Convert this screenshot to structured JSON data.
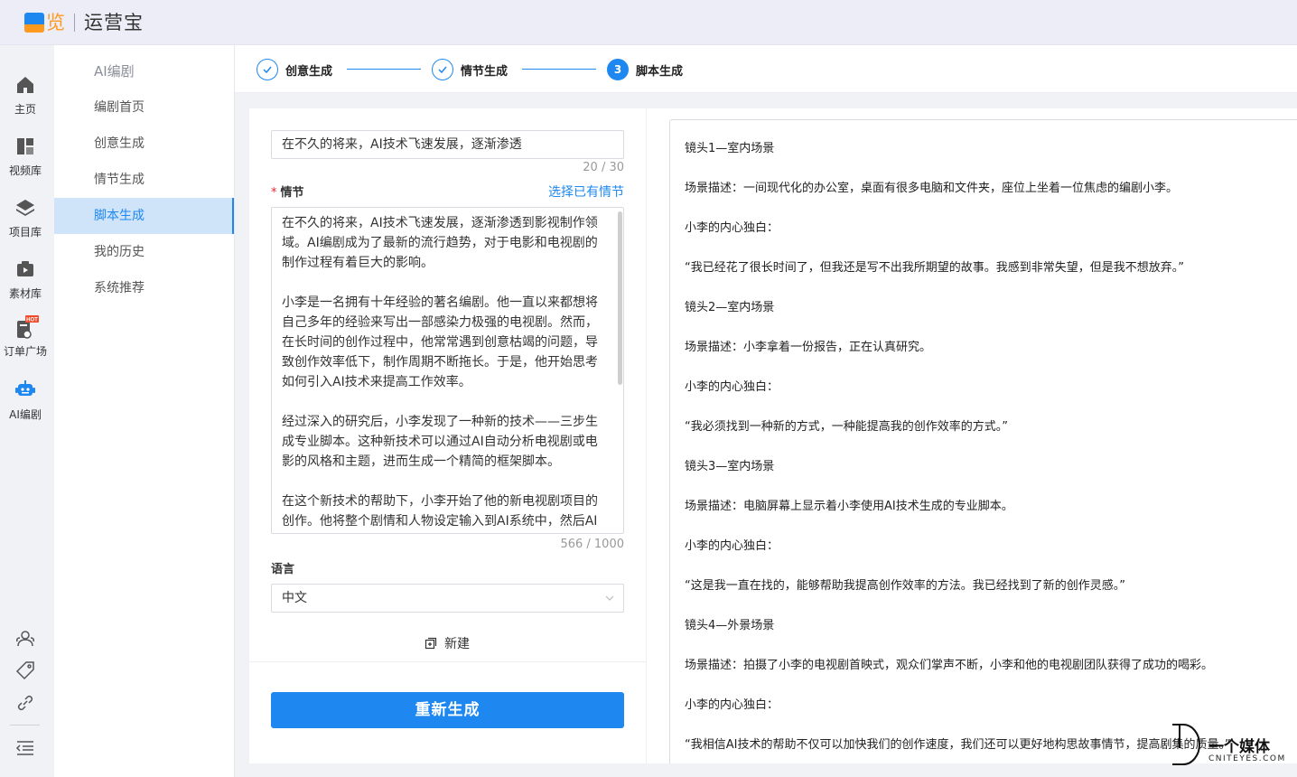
{
  "app": {
    "logo_char": "览",
    "name": "运营宝"
  },
  "rail": {
    "items": [
      {
        "label": "主页",
        "icon": "home-icon"
      },
      {
        "label": "视频库",
        "icon": "video-library-icon"
      },
      {
        "label": "项目库",
        "icon": "layers-icon"
      },
      {
        "label": "素材库",
        "icon": "media-icon"
      },
      {
        "label": "订单广场",
        "icon": "order-icon",
        "badge": "HOT"
      },
      {
        "label": "AI编剧",
        "icon": "robot-icon",
        "active": true
      }
    ],
    "bottom_icons": [
      "user-group-icon",
      "tag-icon",
      "link-icon",
      "menu-collapse-icon"
    ]
  },
  "submenu": {
    "title": "AI编剧",
    "items": [
      {
        "label": "编剧首页"
      },
      {
        "label": "创意生成"
      },
      {
        "label": "情节生成"
      },
      {
        "label": "脚本生成",
        "active": true
      },
      {
        "label": "我的历史"
      },
      {
        "label": "系统推荐"
      }
    ]
  },
  "steps": [
    {
      "label": "创意生成",
      "state": "done"
    },
    {
      "label": "情节生成",
      "state": "done"
    },
    {
      "label": "脚本生成",
      "state": "current",
      "number": "3"
    }
  ],
  "form": {
    "title_value": "在不久的将来，AI技术飞速发展，逐渐渗透",
    "title_count": "20 / 30",
    "plot_required": "*",
    "plot_label": "情节",
    "plot_link": "选择已有情节",
    "plot_paragraphs": [
      "在不久的将来，AI技术飞速发展，逐渐渗透到影视制作领域。AI编剧成为了最新的流行趋势，对于电影和电视剧的制作过程有着巨大的影响。",
      "小李是一名拥有十年经验的著名编剧。他一直以来都想将自己多年的经验来写出一部感染力极强的电视剧。然而，在长时间的创作过程中，他常常遇到创意枯竭的问题，导致创作效率低下，制作周期不断拖长。于是，他开始思考如何引入AI技术来提高工作效率。",
      "经过深入的研究后，小李发现了一种新的技术——三步生成专业脚本。这种新技术可以通过AI自动分析电视剧或电影的风格和主题，进而生成一个精简的框架脚本。",
      "在这个新技术的帮助下，小李开始了他的新电视剧项目的创作。他将整个剧情和人物设定输入到AI系统中，然后AI"
    ],
    "plot_count": "566 / 1000",
    "language_label": "语言",
    "language_value": "中文",
    "new_label": "新建",
    "regen_label": "重新生成"
  },
  "script_lines": [
    "镜头1—室内场景",
    "场景描述：一间现代化的办公室，桌面有很多电脑和文件夹，座位上坐着一位焦虑的编剧小李。",
    "小李的内心独白：",
    "“我已经花了很长时间了，但我还是写不出我所期望的故事。我感到非常失望，但是我不想放弃。”",
    "镜头2—室内场景",
    "场景描述：小李拿着一份报告，正在认真研究。",
    "小李的内心独白：",
    "“我必须找到一种新的方式，一种能提高我的创作效率的方式。”",
    "镜头3—室内场景",
    "场景描述：电脑屏幕上显示着小李使用AI技术生成的专业脚本。",
    "小李的内心独白：",
    "“这是我一直在找的，能够帮助我提高创作效率的方法。我已经找到了新的创作灵感。”",
    "镜头4—外景场景",
    "场景描述：拍摄了小李的电视剧首映式，观众们掌声不断，小李和他的电视剧团队获得了成功的喝彩。",
    "小李的内心独白：",
    "“我相信AI技术的帮助不仅可以加快我们的创作速度，我们还可以更好地构思故事情节，提高剧集的质量。”"
  ],
  "watermark": {
    "cn": "一个媒体",
    "en": "CNITEYES.COM"
  },
  "colors": {
    "accent": "#1e88f0",
    "logo_orange": "#ff9a1f",
    "active_menu_bg": "#cfe4f8",
    "required": "#f5222d"
  }
}
